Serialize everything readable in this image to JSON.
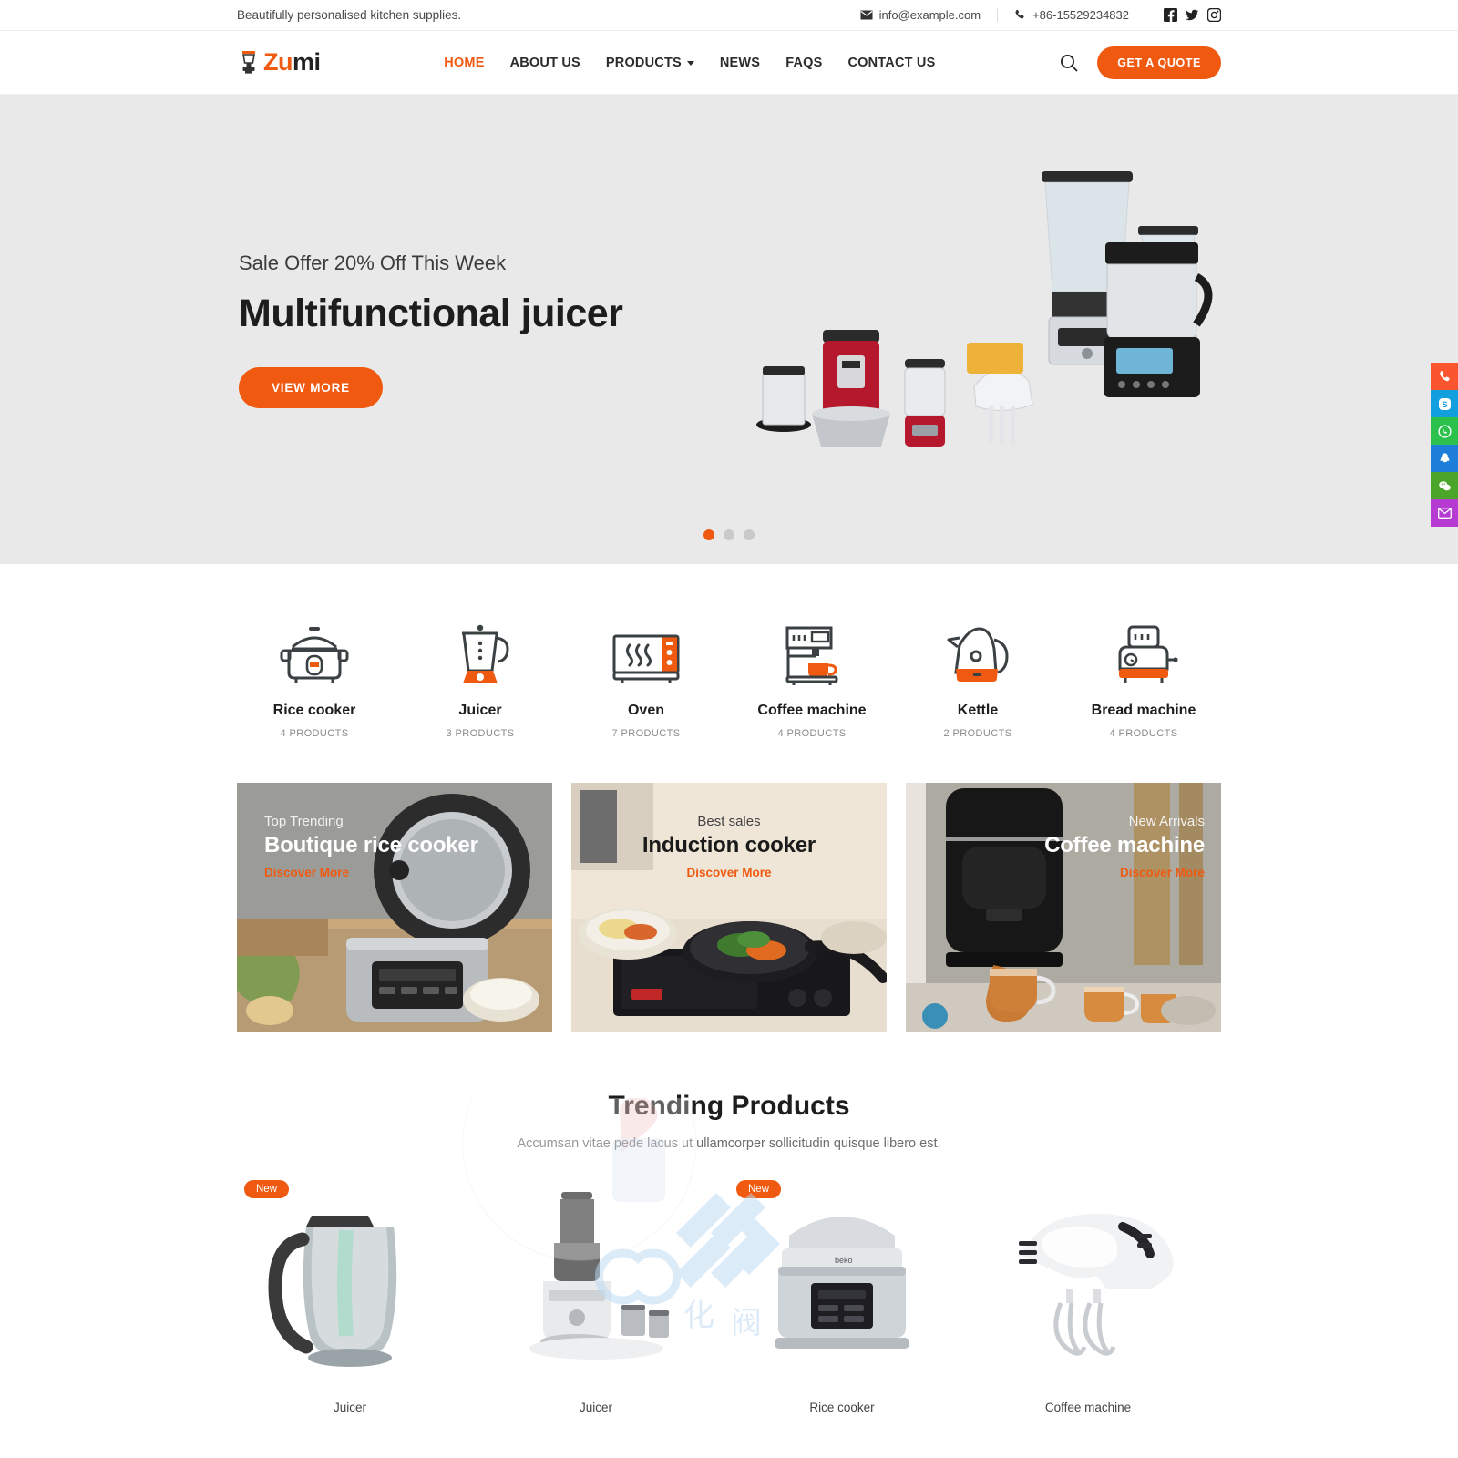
{
  "topbar": {
    "tagline": "Beautifully personalised kitchen supplies.",
    "email": "info@example.com",
    "phone": "+86-15529234832",
    "socials": [
      "facebook-icon",
      "twitter-icon",
      "instagram-icon"
    ]
  },
  "header": {
    "logo_text_1": "Z",
    "logo_text_2": "u",
    "logo_text_3": "mi",
    "nav": [
      {
        "label": "HOME",
        "active": true,
        "has_caret": false
      },
      {
        "label": "ABOUT US",
        "active": false,
        "has_caret": false
      },
      {
        "label": "PRODUCTS",
        "active": false,
        "has_caret": true
      },
      {
        "label": "NEWS",
        "active": false,
        "has_caret": false
      },
      {
        "label": "FAQS",
        "active": false,
        "has_caret": false
      },
      {
        "label": "CONTACT US",
        "active": false,
        "has_caret": false
      }
    ],
    "search_icon": "search-icon",
    "quote_button": "GET A QUOTE"
  },
  "hero": {
    "subtitle": "Sale Offer 20% Off This Week",
    "title": "Multifunctional juicer",
    "button": "VIEW MORE",
    "slide_count": 3,
    "active_slide": 1
  },
  "categories": [
    {
      "name": "Rice cooker",
      "count": "4 PRODUCTS",
      "icon": "rice-cooker-icon"
    },
    {
      "name": "Juicer",
      "count": "3 PRODUCTS",
      "icon": "juicer-icon"
    },
    {
      "name": "Oven",
      "count": "7 PRODUCTS",
      "icon": "oven-icon"
    },
    {
      "name": "Coffee machine",
      "count": "4 PRODUCTS",
      "icon": "coffee-machine-icon"
    },
    {
      "name": "Kettle",
      "count": "2 PRODUCTS",
      "icon": "kettle-icon"
    },
    {
      "name": "Bread machine",
      "count": "4 PRODUCTS",
      "icon": "bread-machine-icon"
    }
  ],
  "banners": [
    {
      "kicker": "Top Trending",
      "title": "Boutique rice cooker",
      "link": "Discover More",
      "align": "left"
    },
    {
      "kicker": "Best sales",
      "title": "Induction cooker",
      "link": "Discover More",
      "align": "center"
    },
    {
      "kicker": "New Arrivals",
      "title": "Coffee machine",
      "link": "Discover More",
      "align": "right"
    }
  ],
  "trending": {
    "title": "Trending Products",
    "subtitle": "Accumsan vitae pede lacus ut ullamcorper sollicitudin quisque libero est.",
    "products": [
      {
        "name": "Juicer",
        "badge": "New"
      },
      {
        "name": "Juicer",
        "badge": ""
      },
      {
        "name": "Rice cooker",
        "badge": "New"
      },
      {
        "name": "Coffee machine",
        "badge": ""
      }
    ]
  },
  "side_rail": [
    {
      "icon": "phone-icon",
      "name": "phone"
    },
    {
      "icon": "skype-icon",
      "name": "skype"
    },
    {
      "icon": "whatsapp-icon",
      "name": "whatsapp"
    },
    {
      "icon": "qq-icon",
      "name": "qq"
    },
    {
      "icon": "wechat-icon",
      "name": "wechat"
    },
    {
      "icon": "email-icon",
      "name": "email"
    }
  ],
  "colors": {
    "accent": "#f05a10",
    "hero_bg": "#e9e9e9",
    "text": "#1d1d1d"
  }
}
